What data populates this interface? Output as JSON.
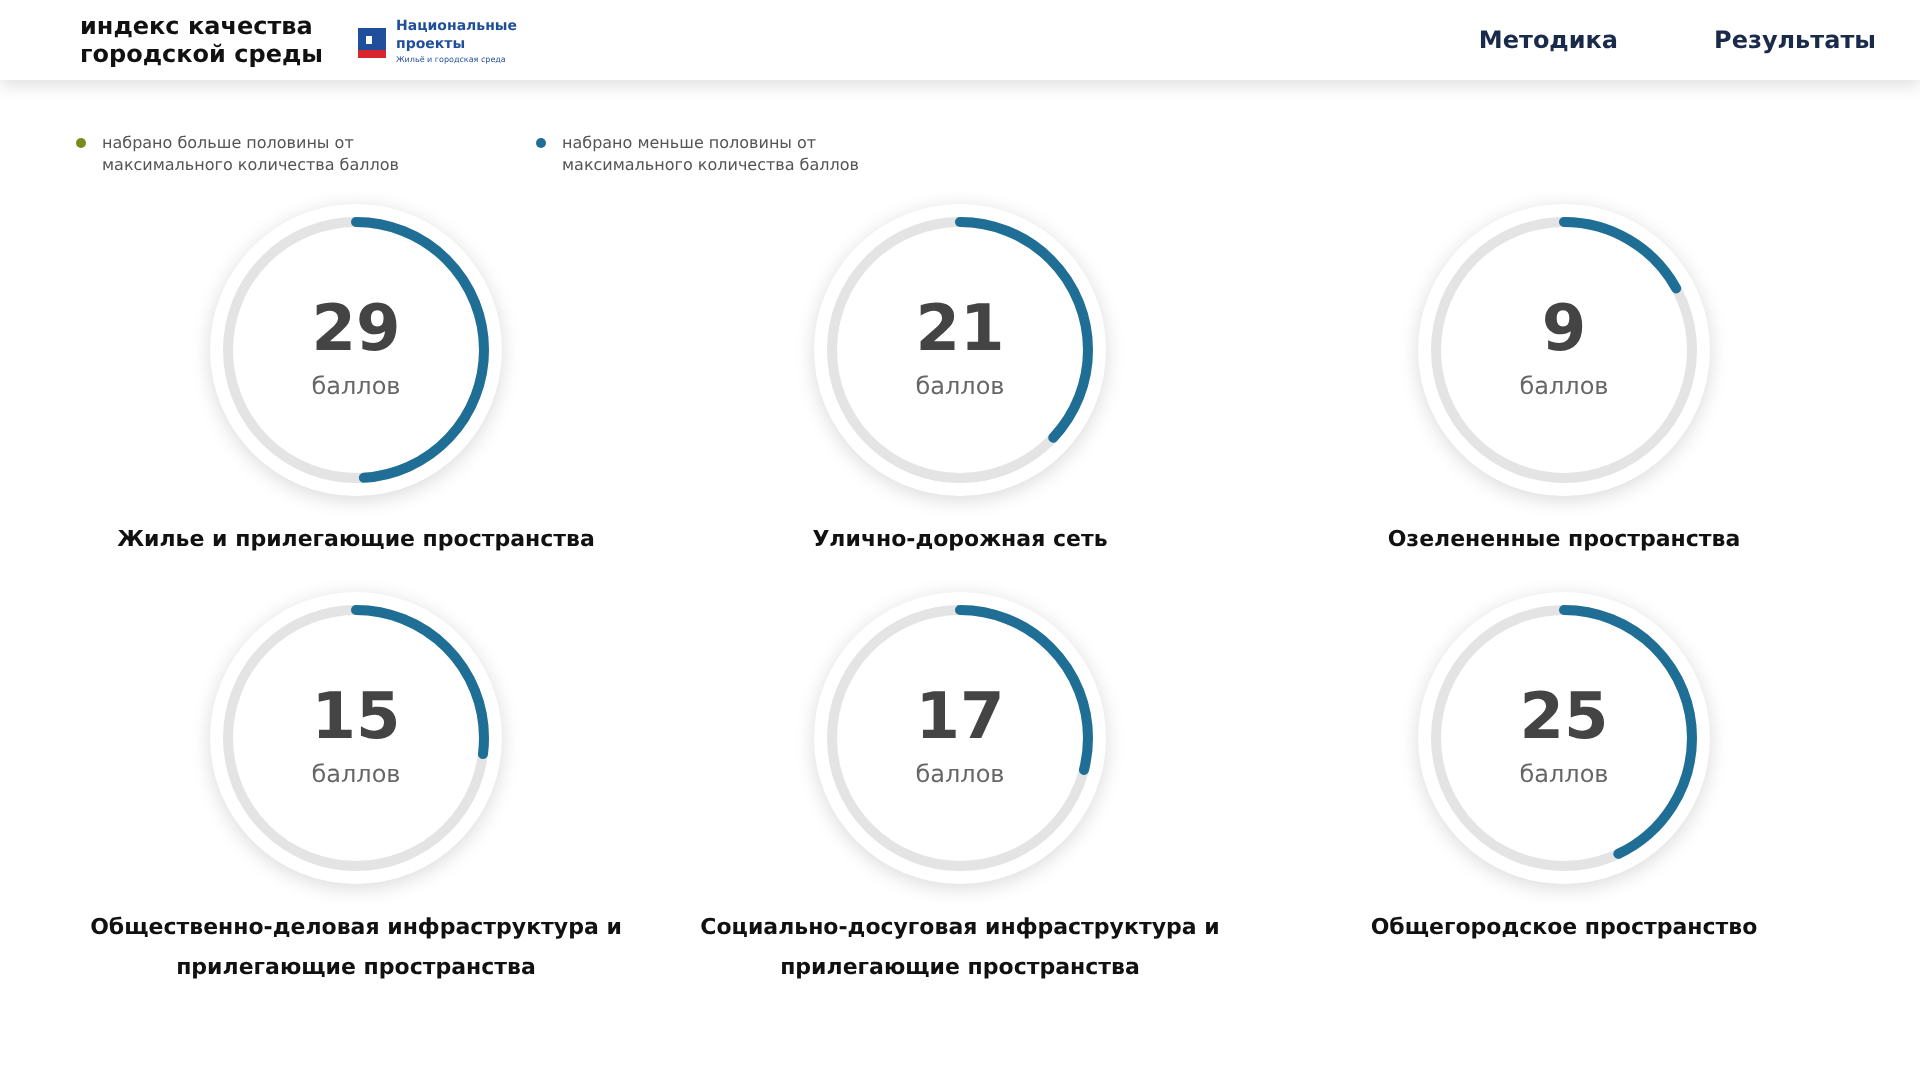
{
  "header": {
    "title": "индекс качества городской среды",
    "logo": {
      "name": "Национальные проекты",
      "subtitle": "Жильё и городская среда"
    },
    "nav": [
      {
        "label": "Методика"
      },
      {
        "label": "Результаты"
      }
    ]
  },
  "legend": [
    {
      "label": "набрано больше половины от максимального количества баллов",
      "color": "#7a8b1e"
    },
    {
      "label": "набрано меньше половины от максимального количества баллов",
      "color": "#1f6e96"
    }
  ],
  "scores": [
    {
      "value": "29",
      "unit": "баллов",
      "label": "Жилье и прилегающие пространства",
      "level": 0.49
    },
    {
      "value": "21",
      "unit": "баллов",
      "label": "Улично-дорожная сеть",
      "level": 0.37
    },
    {
      "value": "9",
      "unit": "баллов",
      "label": "Озелененные пространства",
      "level": 0.17
    },
    {
      "value": "15",
      "unit": "баллов",
      "label": "Общественно-деловая инфраструктура и прилегающие пространства",
      "level": 0.27
    },
    {
      "value": "17",
      "unit": "баллов",
      "label": "Социально-досуговая инфраструктура и прилегающие пространства",
      "level": 0.29
    },
    {
      "value": "25",
      "unit": "баллов",
      "label": "Общегородское пространство",
      "level": 0.43
    }
  ]
}
